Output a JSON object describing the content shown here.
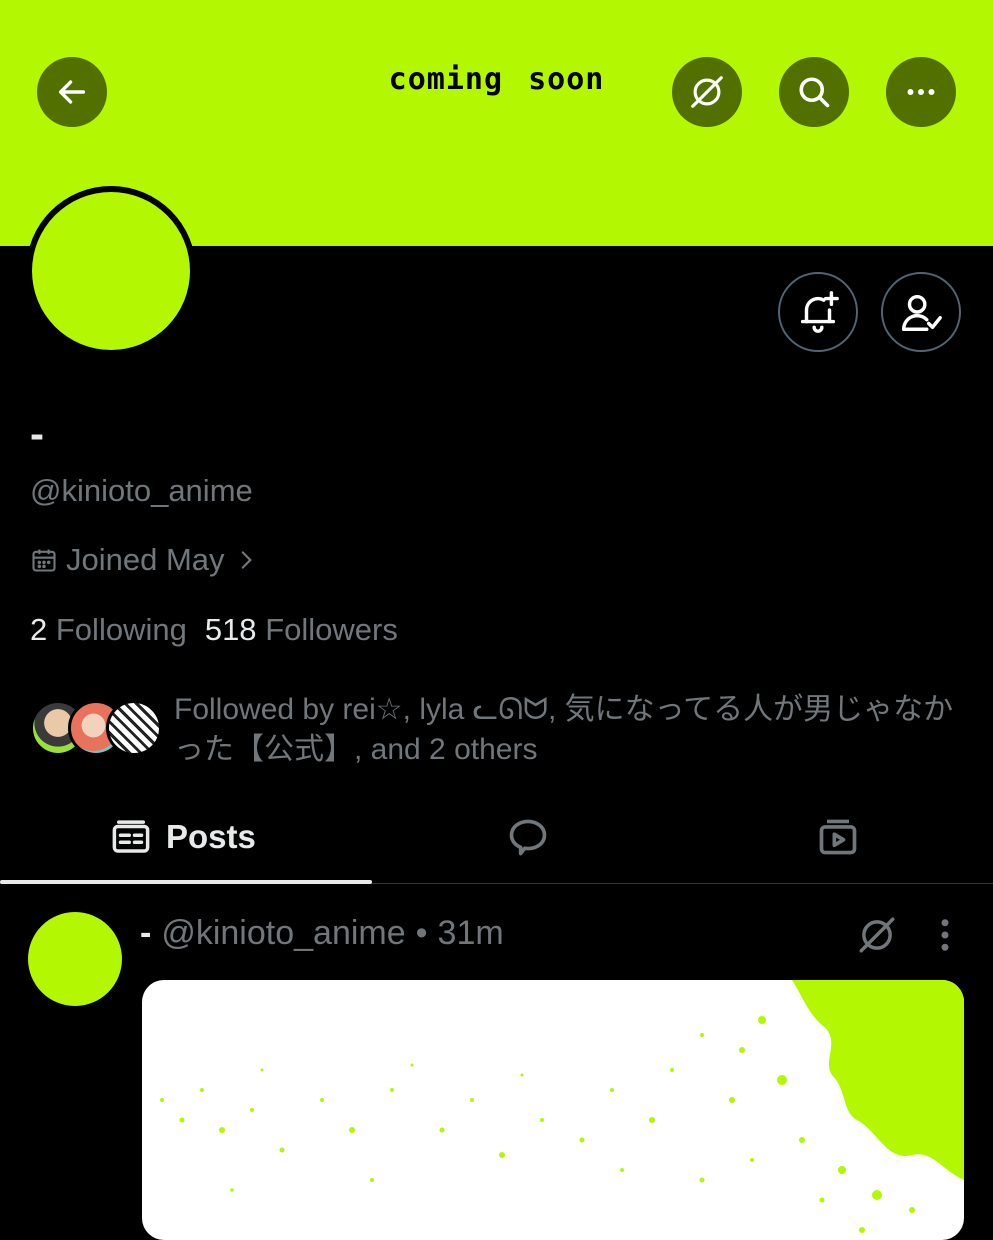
{
  "header": {
    "title": "coming soon",
    "back_icon": "arrow-left-icon",
    "grok_icon": "grok-icon",
    "search_icon": "search-icon",
    "more_icon": "more-horizontal-icon"
  },
  "colors": {
    "accent": "#b3f802",
    "muted": "#71767b",
    "text": "#e7e9ea"
  },
  "profile": {
    "display_name": "-",
    "handle": "@kinioto_anime",
    "joined": "Joined May",
    "following_count": "2",
    "following_label": "Following",
    "followers_count": "518",
    "followers_label": "Followers",
    "followed_by": "Followed by rei☆, lyla ᓚᘏᗢ, 気になってる人が男じゃなかった【公式】, and 2 others"
  },
  "tabs": [
    {
      "label": "Posts",
      "icon": "posts-icon",
      "active": true
    },
    {
      "label": "",
      "icon": "replies-icon",
      "active": false
    },
    {
      "label": "",
      "icon": "media-icon",
      "active": false
    }
  ],
  "post": {
    "name": "-",
    "handle": "@kinioto_anime",
    "separator": "•",
    "time": "31m"
  }
}
